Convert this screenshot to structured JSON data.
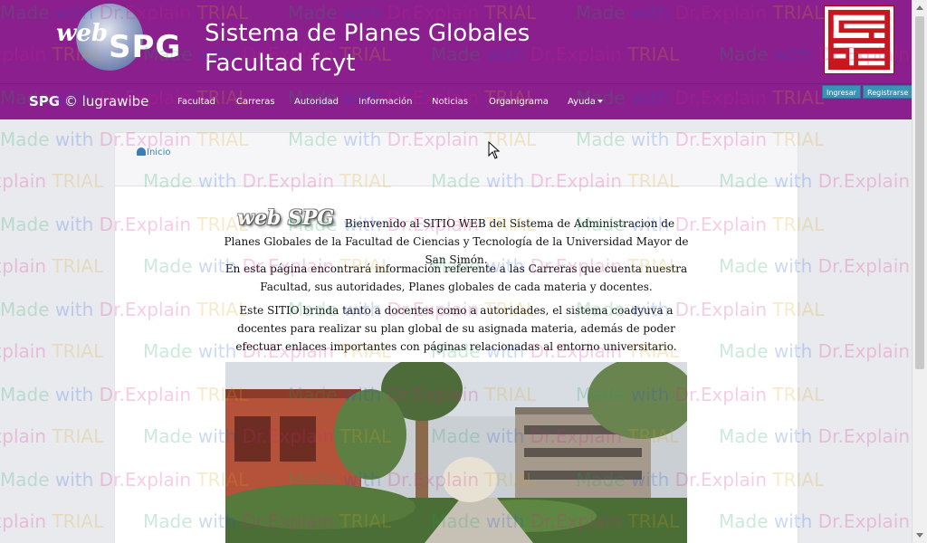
{
  "header": {
    "logo_web": "web",
    "logo_spg": "SPG",
    "title_line1": "Sistema de Planes Globales",
    "title_line2": "Facultad fcyt"
  },
  "navbar": {
    "brand_bold": "SPG",
    "brand_rest": " © lugrawibe",
    "items": [
      {
        "label": "Facultad"
      },
      {
        "label": "Carreras"
      },
      {
        "label": "Autoridad"
      },
      {
        "label": "Información"
      },
      {
        "label": "Noticias"
      },
      {
        "label": "Organigrama"
      },
      {
        "label": "Ayuda"
      }
    ],
    "login_label": "Ingresar",
    "register_label": "Registrarse"
  },
  "breadcrumb": {
    "home_label": "Inicio"
  },
  "content": {
    "intro_logo": "web SPG",
    "paragraph1": "Bienvenido al SITIO WEB del Sistema de Administracion de Planes Globales de la Facultad de Ciencias y Tecnología de la Universidad Mayor de San Simón.",
    "paragraph2": "En esta página encontrará información referente a las Carreras que cuenta nuestra Facultad, sus autoridades, Planes globales de cada materia y docentes.",
    "paragraph3": "Este SITIO brinda tanto a docentes como a autoridades, el sistema coadyuva a docentes para realizar su plan global de su asignada materia, además de poder efectuar enlaces importantes con páginas relacionadas al entorno universitario."
  },
  "watermark": {
    "w1": "Made",
    "w2": "with",
    "w3": "Dr.Explain",
    "w4": "TRIAL"
  },
  "colors": {
    "header_bg": "#8a1f8d",
    "button_bg": "#3a92b5",
    "link": "#3a7fb5",
    "page_bg": "#e9eaee"
  }
}
